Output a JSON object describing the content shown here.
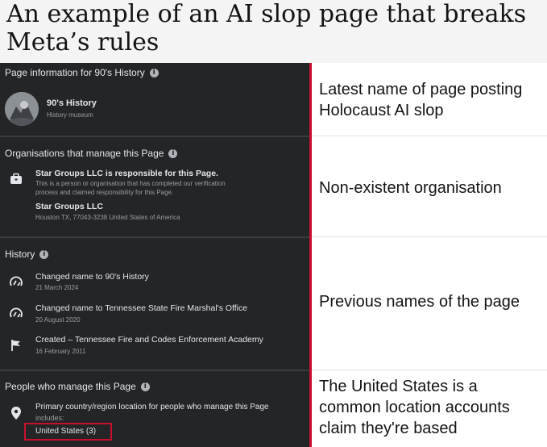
{
  "headline": "An example of an AI slop page that breaks Meta’s rules",
  "page_info": {
    "title": "Page information for 90's History",
    "page_name": "90's History",
    "category": "History museum"
  },
  "organisations": {
    "title": "Organisations that manage this Page",
    "responsible": "Star Groups LLC is responsible for this Page.",
    "desc_line1": "This is a person or organisation that has completed our verification",
    "desc_line2": "process and claimed responsibility for this Page.",
    "org_name": "Star Groups LLC",
    "address": "Houston TX, 77043-3238 United States of America"
  },
  "history": {
    "title": "History",
    "items": [
      {
        "label": "Changed name to 90's History",
        "date": "21 March 2024"
      },
      {
        "label": "Changed name to Tennessee State Fire Marshal's Office",
        "date": "20 August 2020"
      },
      {
        "label": "Created – Tennessee Fire and Codes Enforcement Academy",
        "date": "16 February 2011"
      }
    ]
  },
  "people": {
    "title": "People who manage this Page",
    "line1": "Primary country/region location for people who manage this Page",
    "line2": "includes:",
    "location": "United States (3)"
  },
  "annotations": {
    "a1_l1": "Latest name of page posting",
    "a1_l2": "Holocaust AI slop",
    "a2": "Non-existent organisation",
    "a3": "Previous names of the page",
    "a4_l1": "The United States is a",
    "a4_l2": "common location accounts",
    "a4_l3": "claim they're based"
  },
  "colors": {
    "panel_bg": "#242526",
    "accent_red": "#c8102e",
    "text_light": "#e4e6eb",
    "text_muted": "#9a9da2"
  }
}
